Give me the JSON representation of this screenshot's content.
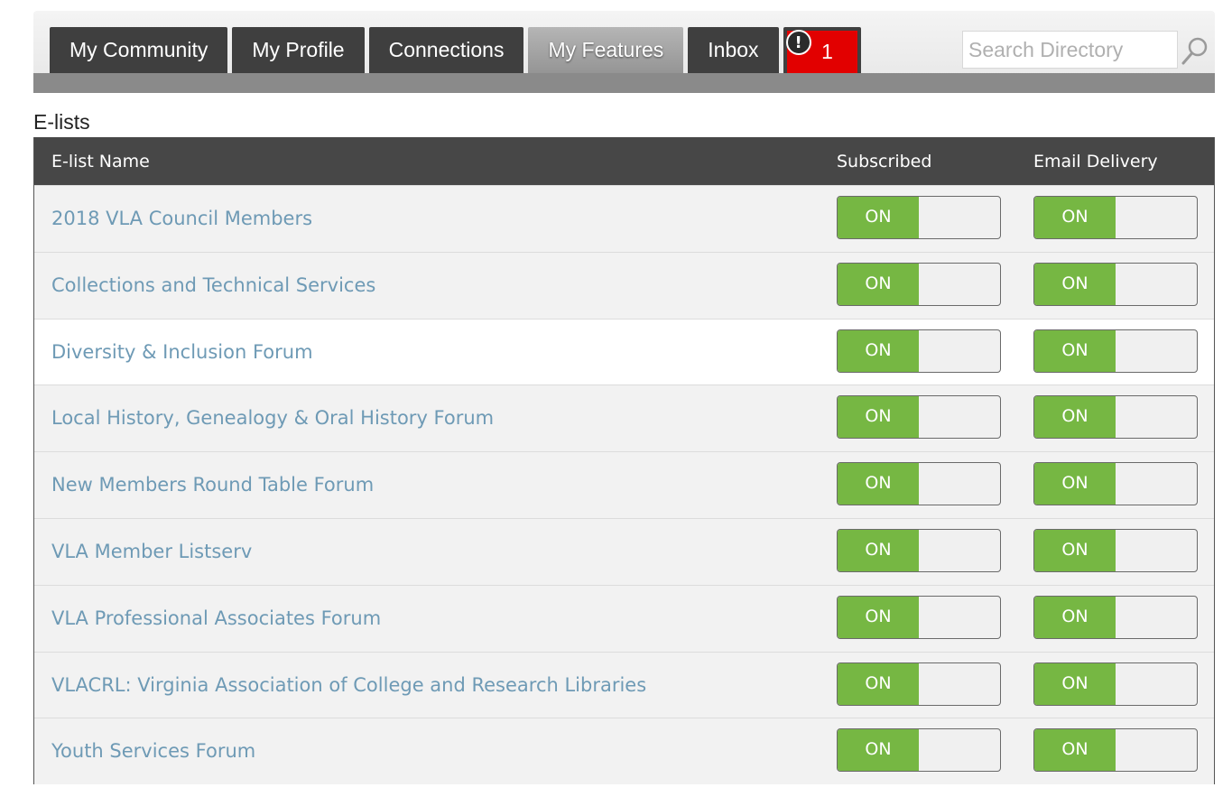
{
  "nav": {
    "tabs": [
      {
        "label": "My Community",
        "active": false
      },
      {
        "label": "My Profile",
        "active": false
      },
      {
        "label": "Connections",
        "active": false
      },
      {
        "label": "My Features",
        "active": true
      },
      {
        "label": "Inbox",
        "active": false
      }
    ],
    "alert": {
      "icon": "exclamation-icon",
      "count": "1",
      "color": "#e20000"
    },
    "search": {
      "placeholder": "Search Directory",
      "icon": "search-icon"
    }
  },
  "section": {
    "title": "E-lists",
    "columns": {
      "name": "E-list Name",
      "subscribed": "Subscribed",
      "email_delivery": "Email Delivery"
    },
    "rows": [
      {
        "name": "2018 VLA Council Members",
        "subscribed": "ON",
        "email": "ON"
      },
      {
        "name": "Collections and Technical Services",
        "subscribed": "ON",
        "email": "ON"
      },
      {
        "name": "Diversity & Inclusion Forum",
        "subscribed": "ON",
        "email": "ON"
      },
      {
        "name": "Local History, Genealogy & Oral History Forum",
        "subscribed": "ON",
        "email": "ON"
      },
      {
        "name": "New Members Round Table Forum",
        "subscribed": "ON",
        "email": "ON"
      },
      {
        "name": "VLA Member Listserv",
        "subscribed": "ON",
        "email": "ON"
      },
      {
        "name": "VLA Professional Associates Forum",
        "subscribed": "ON",
        "email": "ON"
      },
      {
        "name": "VLACRL: Virginia Association of College and Research Libraries",
        "subscribed": "ON",
        "email": "ON"
      },
      {
        "name": "Youth Services Forum",
        "subscribed": "ON",
        "email": "ON"
      }
    ]
  },
  "colors": {
    "toggle_on": "#76b743",
    "link": "#6e9ab5",
    "header_bg": "#474747",
    "tab_bg": "#3f3f3f"
  }
}
